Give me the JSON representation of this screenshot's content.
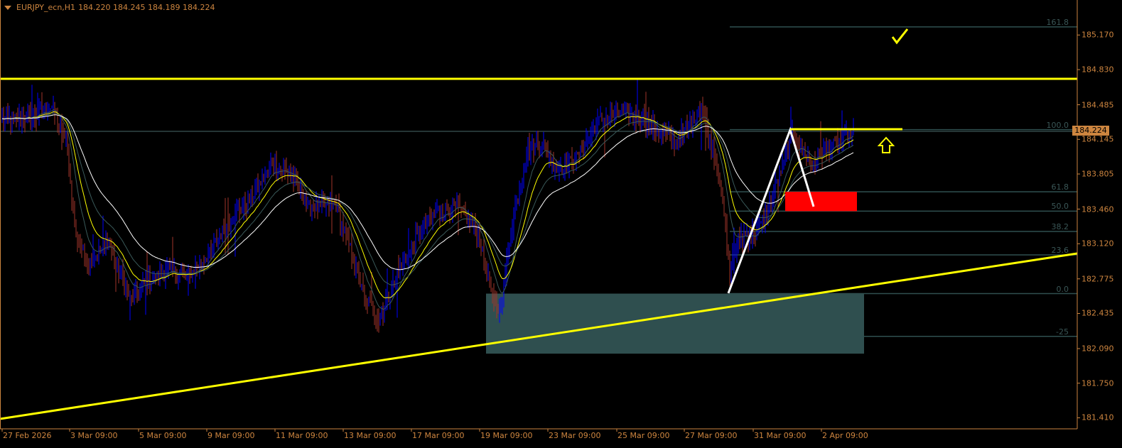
{
  "header": {
    "symbol": "EURJPY_ecn,H1",
    "ohlc": "184.220 184.245 184.189 184.224"
  },
  "colors": {
    "background": "#000000",
    "axis": "#cd853f",
    "bull_bar": "#0000ff",
    "bear_bar": "#a0342a",
    "fib": "#2f4f4f",
    "zone": "#2f4f4f",
    "resistance": "#ffff00",
    "red_zone": "#ff0000"
  },
  "chart_data": {
    "type": "candlestick",
    "title": "EURJPY_ecn,H1",
    "current_price": "184.224",
    "ylim": [
      181.3,
      185.45
    ],
    "y_ticks": [
      "185.170",
      "184.830",
      "184.485",
      "184.145",
      "183.805",
      "183.460",
      "183.120",
      "182.775",
      "182.435",
      "182.090",
      "181.750",
      "181.410"
    ],
    "x_ticks": [
      "27 Feb 2026",
      "3 Mar 09:00",
      "5 Mar 09:00",
      "9 Mar 09:00",
      "11 Mar 09:00",
      "13 Mar 09:00",
      "17 Mar 09:00",
      "19 Mar 09:00",
      "23 Mar 09:00",
      "25 Mar 09:00",
      "27 Mar 09:00",
      "31 Mar 09:00",
      "2 Apr 09:00"
    ],
    "price_path_keypoints": [
      [
        0,
        184.33
      ],
      [
        20,
        184.36
      ],
      [
        35,
        184.47
      ],
      [
        45,
        184.12
      ],
      [
        52,
        183.21
      ],
      [
        60,
        182.93
      ],
      [
        75,
        183.14
      ],
      [
        90,
        182.58
      ],
      [
        100,
        182.72
      ],
      [
        115,
        182.86
      ],
      [
        130,
        182.79
      ],
      [
        145,
        183.0
      ],
      [
        160,
        183.35
      ],
      [
        175,
        183.56
      ],
      [
        190,
        183.91
      ],
      [
        205,
        183.77
      ],
      [
        215,
        183.49
      ],
      [
        235,
        183.49
      ],
      [
        245,
        183.07
      ],
      [
        255,
        182.58
      ],
      [
        265,
        182.38
      ],
      [
        275,
        182.72
      ],
      [
        290,
        183.14
      ],
      [
        305,
        183.42
      ],
      [
        320,
        183.49
      ],
      [
        335,
        183.21
      ],
      [
        345,
        182.58
      ],
      [
        350,
        182.45
      ],
      [
        360,
        183.42
      ],
      [
        370,
        184.05
      ],
      [
        380,
        184.12
      ],
      [
        390,
        183.84
      ],
      [
        405,
        183.98
      ],
      [
        420,
        184.33
      ],
      [
        435,
        184.4
      ],
      [
        450,
        184.36
      ],
      [
        465,
        184.19
      ],
      [
        475,
        184.12
      ],
      [
        485,
        184.33
      ],
      [
        492,
        184.47
      ],
      [
        500,
        184.05
      ],
      [
        505,
        183.77
      ],
      [
        512,
        182.86
      ],
      [
        520,
        183.21
      ],
      [
        530,
        183.21
      ],
      [
        540,
        183.49
      ],
      [
        556,
        184.19
      ],
      [
        570,
        183.91
      ],
      [
        580,
        184.05
      ],
      [
        600,
        184.22
      ]
    ],
    "indicators": [
      "EMA fast (gray)",
      "EMA (yellow)",
      "EMA slow (gray)",
      "EMA 55 (white)"
    ],
    "horizontal_levels": [
      184.74
    ],
    "trendline": {
      "from": [
        0,
        181.46
      ],
      "to": [
        600,
        183.09
      ]
    },
    "fibonacci": {
      "levels": [
        {
          "label": "161.8",
          "price": 185.25
        },
        {
          "label": "100.0",
          "price": 184.24
        },
        {
          "label": "61.8",
          "price": 183.63
        },
        {
          "label": "50.0",
          "price": 183.44
        },
        {
          "label": "38.2",
          "price": 183.24
        },
        {
          "label": "23.6",
          "price": 183.01
        },
        {
          "label": "0.0",
          "price": 182.63
        },
        {
          "label": "-25",
          "price": 182.21
        }
      ]
    },
    "zones": [
      {
        "name": "demand",
        "price_top": 182.63,
        "price_bottom": 182.04
      },
      {
        "name": "sell",
        "price_top": 183.63,
        "price_bottom": 183.44
      }
    ]
  }
}
